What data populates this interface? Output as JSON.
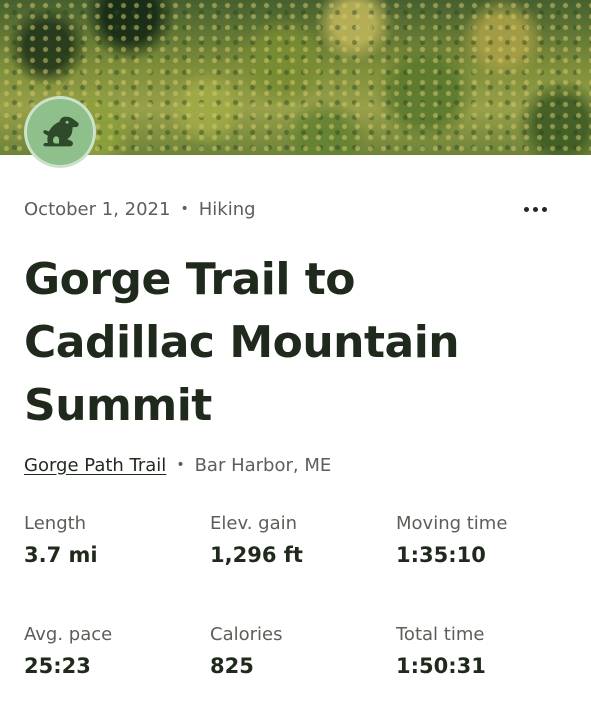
{
  "activity": {
    "date": "October 1, 2021",
    "separator": "•",
    "type": "Hiking",
    "title": "Gorge Trail to Cadillac Mountain Summit",
    "trail_name": "Gorge Path Trail",
    "location": "Bar Harbor, ME"
  },
  "icons": {
    "avatar": "frog-icon",
    "more": "more-horizontal-icon"
  },
  "colors": {
    "avatar_bg": "#8fbf8a",
    "text_primary": "#1f2a1c",
    "text_secondary": "#5c5f58"
  },
  "stats": [
    {
      "label": "Length",
      "value": "3.7 mi"
    },
    {
      "label": "Elev. gain",
      "value": "1,296 ft"
    },
    {
      "label": "Moving time",
      "value": "1:35:10"
    },
    {
      "label": "Avg. pace",
      "value": "25:23"
    },
    {
      "label": "Calories",
      "value": "825"
    },
    {
      "label": "Total time",
      "value": "1:50:31"
    }
  ]
}
